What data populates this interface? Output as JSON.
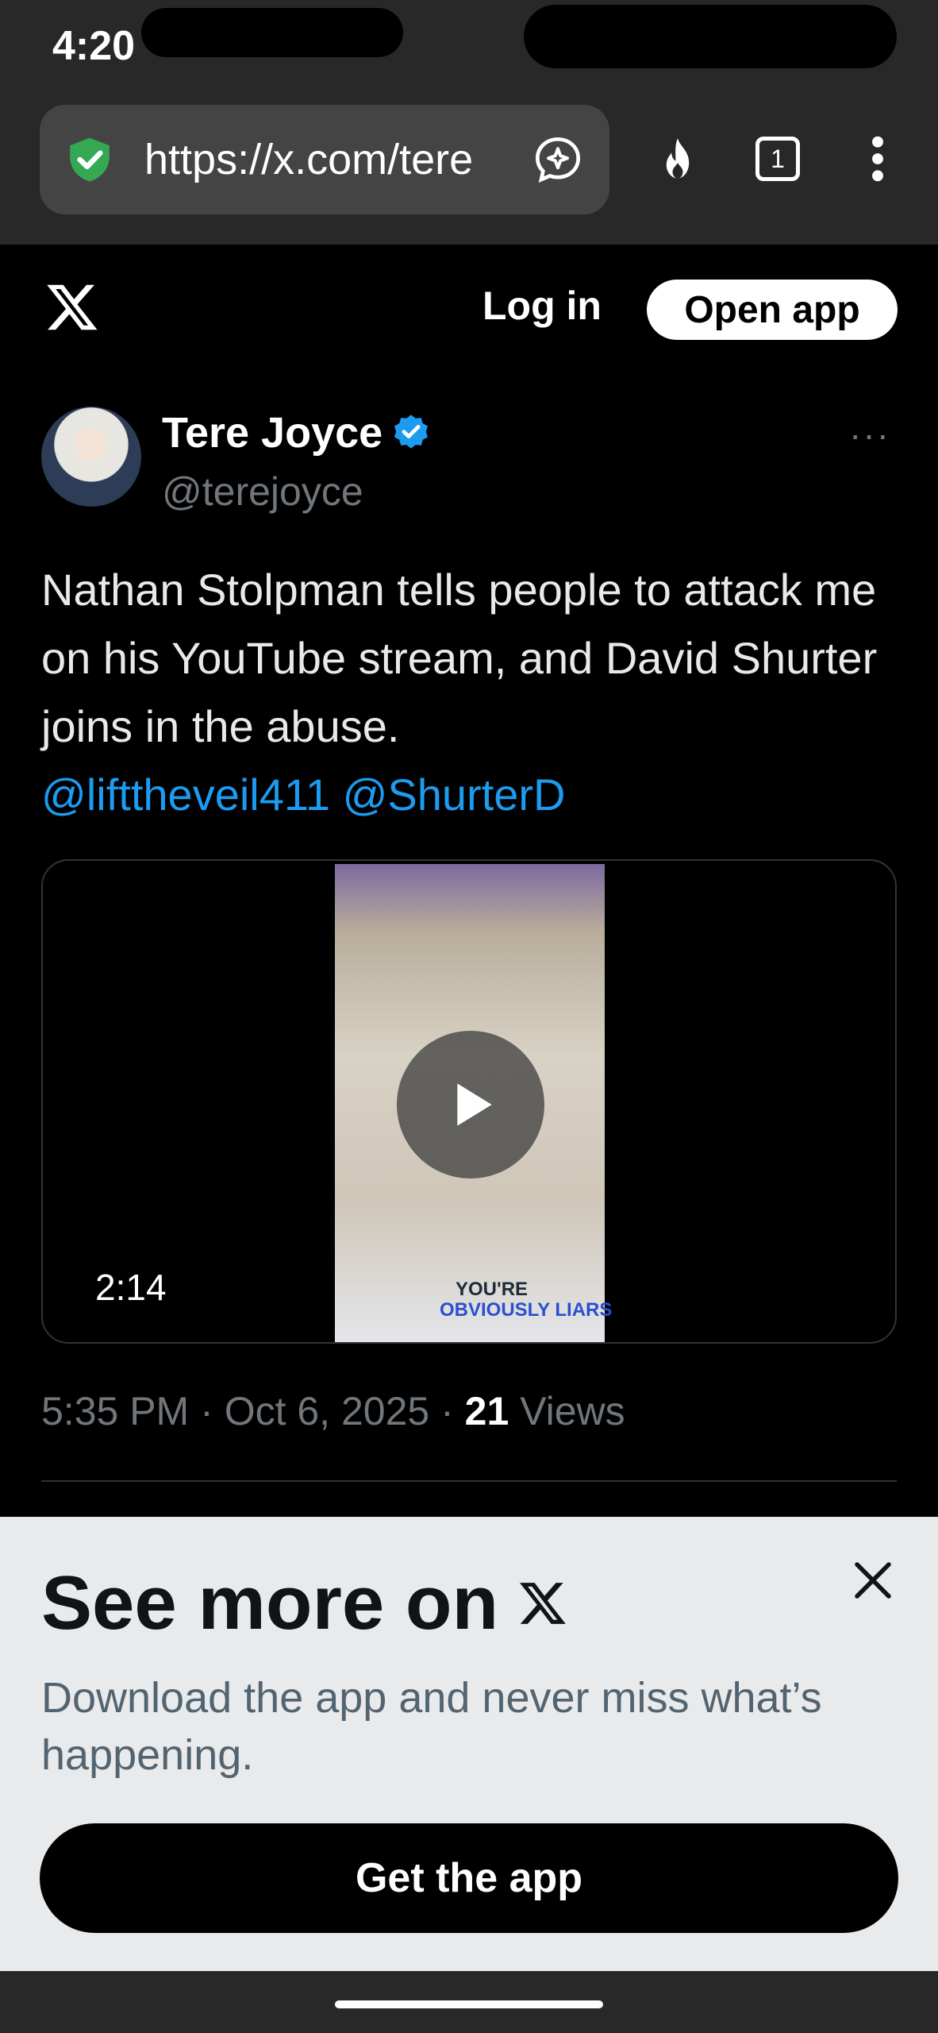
{
  "status_bar": {
    "time": "4:20"
  },
  "browser": {
    "url": "https://x.com/tere",
    "tab_count": "1",
    "icons": {
      "security": "shield-check-icon",
      "assistant": "sparkle-chat-icon",
      "fire": "fire-icon",
      "tabs": "tabs-icon",
      "menu": "more-vert-icon"
    }
  },
  "header": {
    "login_label": "Log in",
    "open_app_label": "Open app"
  },
  "tweet": {
    "author_name": "Tere Joyce",
    "handle": "@terejoyce",
    "more_label": "···",
    "text": "Nathan Stolpman tells people to attack me on his YouTube stream, and David Shurter joins in the abuse.",
    "mentions": [
      "@lifttheveil411",
      "@ShurterD"
    ],
    "video": {
      "duration": "2:14",
      "caption_top": "YOU'RE",
      "caption_bottom": "OBVIOUSLY LIARS"
    },
    "time": "5:35 PM",
    "date": "Oct 6, 2025",
    "views_count": "21",
    "views_label": "Views",
    "separator": "·"
  },
  "sheet": {
    "title": "See more on",
    "subtitle": "Download the app and never miss what’s happening.",
    "button_label": "Get the app"
  },
  "colors": {
    "accent": "#1d9bf0",
    "muted": "#71767b",
    "sheet_bg": "#e9eaec"
  }
}
